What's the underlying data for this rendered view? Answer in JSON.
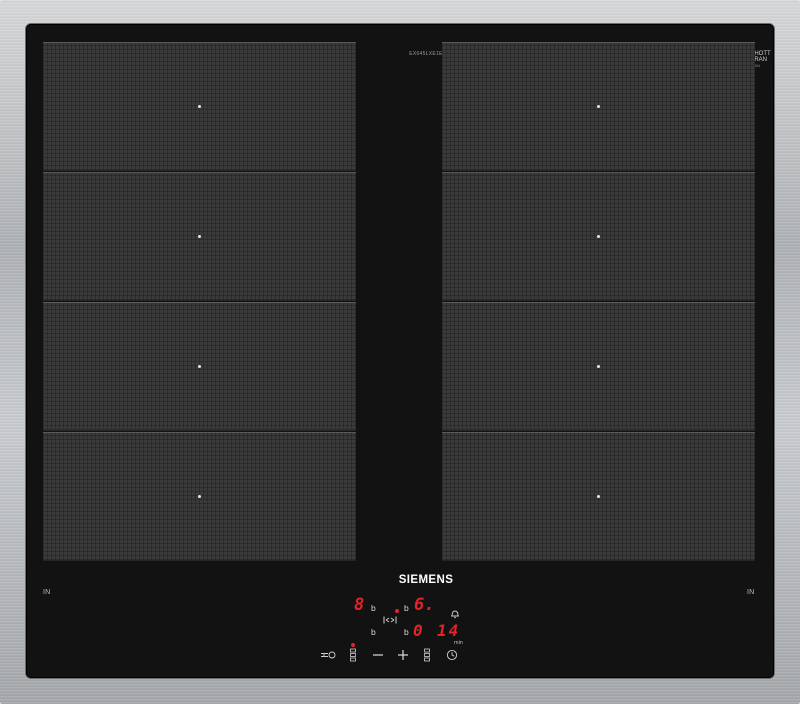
{
  "hob": {
    "model_number": "EX645LXE1E",
    "brand": "SIEMENS",
    "glass_brand": [
      "SCHOTT",
      "CERAN"
    ],
    "glass_brand_small": "CERAN",
    "in_left": "IN",
    "in_right": "IN"
  },
  "zones": [
    {
      "side": "left",
      "row": 1
    },
    {
      "side": "left",
      "row": 2
    },
    {
      "side": "left",
      "row": 3
    },
    {
      "side": "left",
      "row": 4
    },
    {
      "side": "right",
      "row": 1
    },
    {
      "side": "right",
      "row": 2
    },
    {
      "side": "right",
      "row": 3
    },
    {
      "side": "right",
      "row": 4
    }
  ],
  "display": {
    "left_power": "8",
    "left_b_top": "b",
    "left_b_bottom": "b",
    "right_b_top": "b",
    "right_power": "6.",
    "right_b_bottom": "b",
    "timer_zero": "0",
    "timer_value": "14",
    "timer_unit": "min"
  },
  "controls": {
    "flex_icon": "flex-zone-icon",
    "bell_icon": "bell-icon",
    "power_icon": "power-key-icon",
    "zone_select_left_icon": "zone-select-icon",
    "minus_icon": "minus-icon",
    "plus_icon": "plus-icon",
    "zone_select_right_icon": "zone-select-icon",
    "timer_icon": "clock-icon"
  },
  "colors": {
    "display_red": "#e0242a",
    "glass": "#121212",
    "frame": "#b7babd"
  }
}
